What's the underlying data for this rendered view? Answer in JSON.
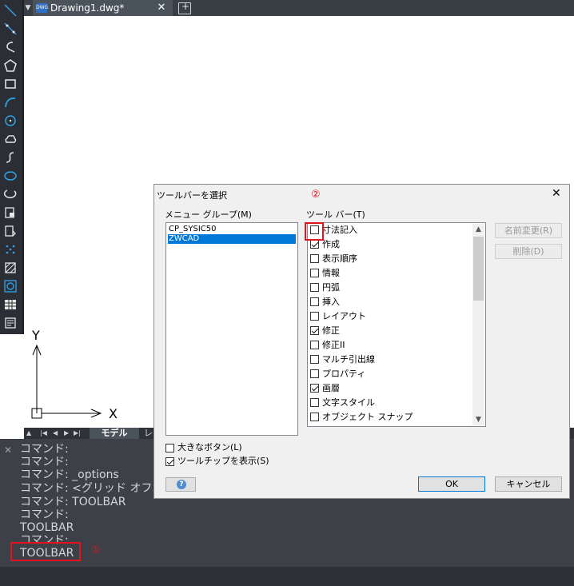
{
  "tabbar": {
    "doc_icon_text": "DWG",
    "tab_label": "Drawing1.dwg*",
    "close_glyph": "✕"
  },
  "left_toolbar": {
    "icons": [
      "line-icon",
      "construction-line-icon",
      "polyline-icon",
      "polygon-icon",
      "rectangle-icon",
      "arc-icon",
      "circle-icon",
      "revision-cloud-icon",
      "spline-icon",
      "ellipse-icon",
      "ellipse-arc-icon",
      "insert-block-icon",
      "make-block-icon",
      "point-icon",
      "hatch-icon",
      "region-icon",
      "table-icon",
      "multiline-text-icon"
    ]
  },
  "drawing": {
    "ucs_y_label": "Y",
    "ucs_x_label": "X"
  },
  "layout_bar": {
    "model_tab": "モデル",
    "layout_tab": "レ"
  },
  "command_window": {
    "lines": [
      "コマンド:",
      "コマンド:",
      "コマンド: _options",
      "コマンド: <グリッド オフ>",
      "コマンド: TOOLBAR",
      "コマンド:",
      "TOOLBAR",
      "コマンド:",
      "TOOLBAR"
    ],
    "marker": "①"
  },
  "dialog": {
    "title": "ツールバーを選択",
    "marker": "②",
    "menu_group_label": "メニュー グループ(M)",
    "toolbar_label": "ツール バー(T)",
    "menu_groups": [
      {
        "label": "CP_SYSIC50",
        "selected": false
      },
      {
        "label": "ZWCAD",
        "selected": true
      }
    ],
    "toolbars": [
      {
        "label": "寸法記入",
        "checked": false
      },
      {
        "label": "作成",
        "checked": true
      },
      {
        "label": "表示順序",
        "checked": false
      },
      {
        "label": "情報",
        "checked": false
      },
      {
        "label": "円弧",
        "checked": false
      },
      {
        "label": "挿入",
        "checked": false
      },
      {
        "label": "レイアウト",
        "checked": false
      },
      {
        "label": "修正",
        "checked": true
      },
      {
        "label": "修正II",
        "checked": false
      },
      {
        "label": "マルチ引出線",
        "checked": false
      },
      {
        "label": "プロパティ",
        "checked": false
      },
      {
        "label": "画層",
        "checked": true
      },
      {
        "label": "文字スタイル",
        "checked": false
      },
      {
        "label": "オブジェクト スナップ",
        "checked": false
      }
    ],
    "buttons": {
      "rename": "名前変更(R)",
      "delete": "削除(D)",
      "ok": "OK",
      "cancel": "キャンセル",
      "help": "?"
    },
    "options": {
      "large_buttons": {
        "label": "大きなボタン(L)",
        "checked": false
      },
      "show_tooltips": {
        "label": "ツールチップを表示(S)",
        "checked": true
      }
    }
  }
}
